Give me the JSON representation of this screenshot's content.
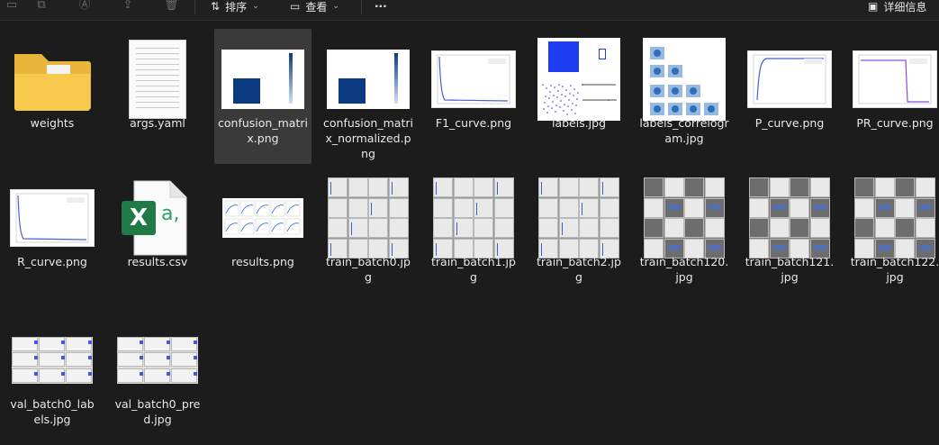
{
  "toolbar": {
    "sort_label": "排序",
    "view_label": "查看",
    "more_label": "···",
    "details_label": "详细信息"
  },
  "files": [
    {
      "name": "weights",
      "label": "weights",
      "kind": "folder"
    },
    {
      "name": "args-yaml",
      "label": "args.yaml",
      "kind": "text"
    },
    {
      "name": "confusion-matrix",
      "label": "confusion_matrix.png",
      "kind": "confusion"
    },
    {
      "name": "confusion-matrix-normalized",
      "label": "confusion_matrix_normalized.png",
      "kind": "confusion"
    },
    {
      "name": "f1-curve",
      "label": "F1_curve.png",
      "kind": "curve"
    },
    {
      "name": "labels",
      "label": "labels.jpg",
      "kind": "labels"
    },
    {
      "name": "labels-correlogram",
      "label": "labels_correlogram.jpg",
      "kind": "correlogram"
    },
    {
      "name": "p-curve",
      "label": "P_curve.png",
      "kind": "pcurve"
    },
    {
      "name": "pr-curve",
      "label": "PR_curve.png",
      "kind": "prcurve"
    },
    {
      "name": "r-curve",
      "label": "R_curve.png",
      "kind": "curve"
    },
    {
      "name": "results-csv",
      "label": "results.csv",
      "kind": "excel"
    },
    {
      "name": "results-png",
      "label": "results.png",
      "kind": "results"
    },
    {
      "name": "train-batch0",
      "label": "train_batch0.jpg",
      "kind": "batch"
    },
    {
      "name": "train-batch1",
      "label": "train_batch1.jpg",
      "kind": "batch"
    },
    {
      "name": "train-batch2",
      "label": "train_batch2.jpg",
      "kind": "batch"
    },
    {
      "name": "train-batch120",
      "label": "train_batch120.jpg",
      "kind": "batchdark"
    },
    {
      "name": "train-batch121",
      "label": "train_batch121.jpg",
      "kind": "batchdark"
    },
    {
      "name": "train-batch122",
      "label": "train_batch122.jpg",
      "kind": "batchdark"
    },
    {
      "name": "val-batch0-labels",
      "label": "val_batch0_labels.jpg",
      "kind": "val"
    },
    {
      "name": "val-batch0-pred",
      "label": "val_batch0_pred.jpg",
      "kind": "val"
    }
  ],
  "selected": "confusion_matrix.png",
  "excel": {
    "letter": "X",
    "suffix": "a,"
  }
}
